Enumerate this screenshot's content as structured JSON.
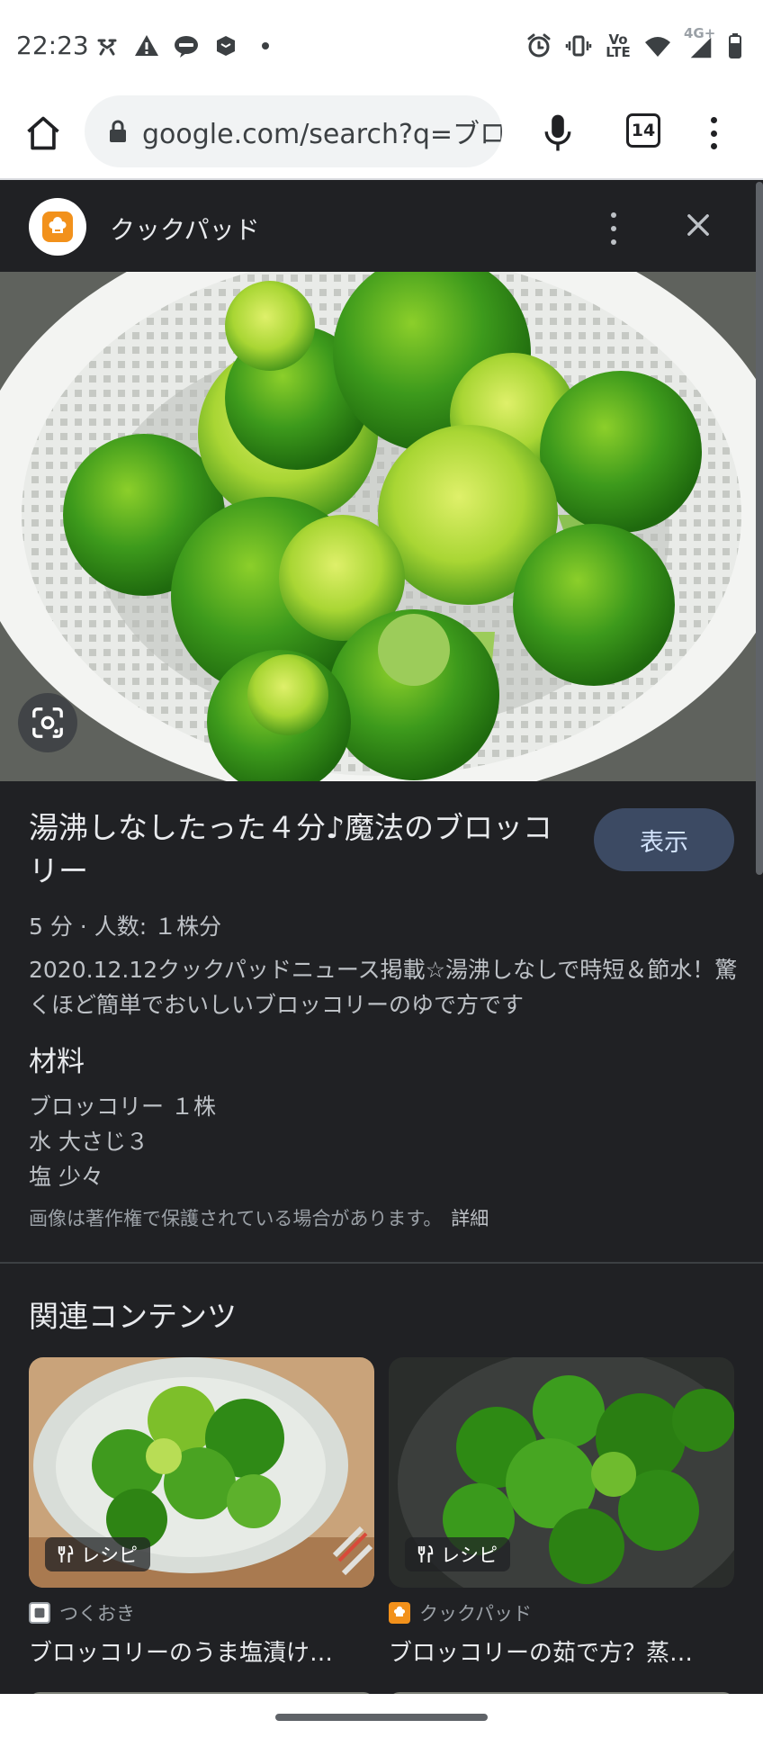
{
  "status_bar": {
    "time": "22:23",
    "left_icons": [
      "drone-icon",
      "warning-icon",
      "line-icon",
      "store-icon",
      "dot-icon"
    ],
    "right_icons": [
      "alarm-icon",
      "vibrate-icon",
      "volte-icon",
      "wifi-icon",
      "signal-icon",
      "battery-icon"
    ],
    "volte_label_1": "Vo",
    "volte_label_2": "LTE",
    "network_label": "4G+"
  },
  "browser": {
    "url": "google.com/search?q=ブロ",
    "tab_count": "14"
  },
  "panel": {
    "site_name": "クックパッド",
    "recipe_title": "湯沸しなしたった４分♪魔法のブロッコリー",
    "view_button": "表示",
    "meta": "5 分 · 人数: １株分",
    "description": "2020.12.12クックパッドニュース掲載☆湯沸しなしで時短＆節水！驚くほど簡単でおいしいブロッコリーのゆで方です",
    "ingredients_heading": "材料",
    "ingredients": [
      "ブロッコリー １株",
      "水 大さじ３",
      "塩 少々"
    ],
    "copyright_notice": "画像は著作権で保護されている場合があります。",
    "copyright_detail": "詳細"
  },
  "related": {
    "heading": "関連コンテンツ",
    "cards": [
      {
        "badge": "レシピ",
        "source": "つくおき",
        "title": "ブロッコリーのうま塩漬け…"
      },
      {
        "badge": "レシピ",
        "source": "クックパッド",
        "title": "ブロッコリーの茹で方？蒸…"
      }
    ]
  },
  "colors": {
    "panel_bg": "#202124",
    "view_button_bg": "#3c4a63",
    "cookpad_orange": "#f2911b",
    "broccoli_green": "#2e7d18"
  }
}
